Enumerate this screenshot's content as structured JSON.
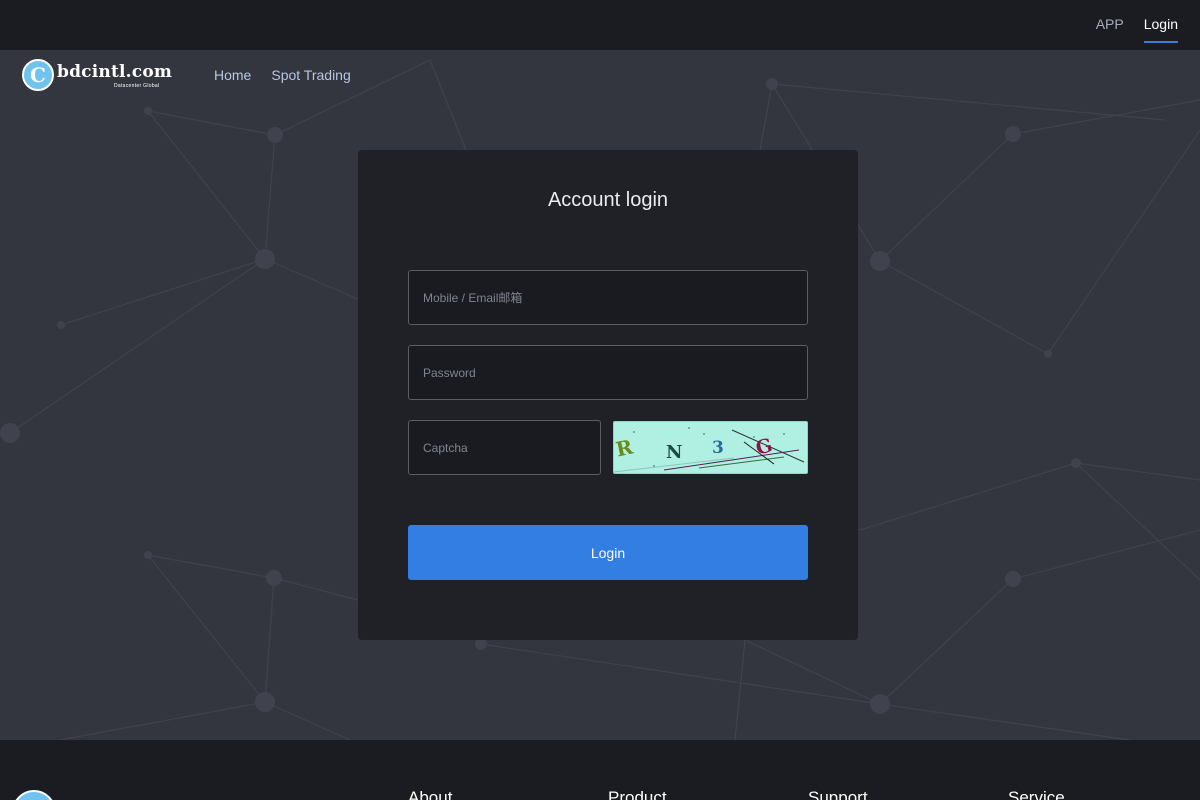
{
  "topbar": {
    "app_label": "APP",
    "login_label": "Login"
  },
  "brand": {
    "logo_letter": "C",
    "name": "bdcintl.com",
    "tagline": "Datacenter Global"
  },
  "nav": {
    "items": [
      {
        "label": "Home"
      },
      {
        "label": "Spot Trading"
      }
    ]
  },
  "login_form": {
    "title": "Account login",
    "username_placeholder": "Mobile / Email邮箱",
    "password_placeholder": "Password",
    "captcha_placeholder": "Captcha",
    "captcha_chars": [
      "R",
      "N",
      "3",
      "G"
    ],
    "captcha_colors": [
      "#6b8a1a",
      "#1f4a3e",
      "#2a6a9a",
      "#8a1448"
    ],
    "submit_label": "Login"
  },
  "footer": {
    "columns": [
      "About",
      "Product",
      "Support",
      "Service"
    ]
  },
  "colors": {
    "accent": "#337ee3",
    "background": "#33353f",
    "card": "#202126",
    "topbar": "#1b1c21",
    "captcha_bg": "#aff0e2"
  }
}
